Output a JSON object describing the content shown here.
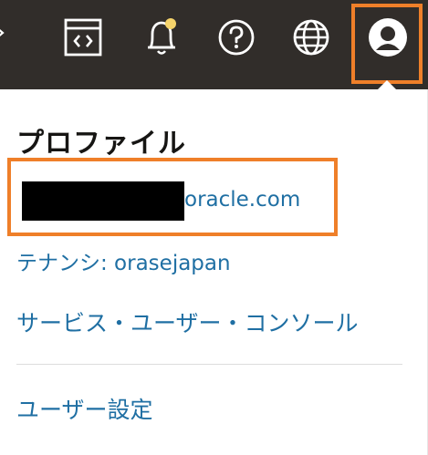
{
  "topbar": {
    "icons": [
      {
        "name": "chevron-left-icon"
      },
      {
        "name": "code-editor-icon"
      },
      {
        "name": "notification-bell-icon"
      },
      {
        "name": "help-icon"
      },
      {
        "name": "language-globe-icon"
      },
      {
        "name": "profile-avatar-icon"
      }
    ],
    "notification_dot_color": "#f6d46b",
    "highlight_color": "#ef7f29"
  },
  "menu": {
    "title": "プロファイル",
    "email_visible": "oracle.com",
    "tenancy_label": "テナンシ: orasejapan",
    "console_label": "サービス・ユーザー・コンソール",
    "user_settings_label": "ユーザー設定"
  },
  "colors": {
    "topbar_bg": "#312d2a",
    "link": "#1f6fa3",
    "highlight": "#ef7f29"
  }
}
